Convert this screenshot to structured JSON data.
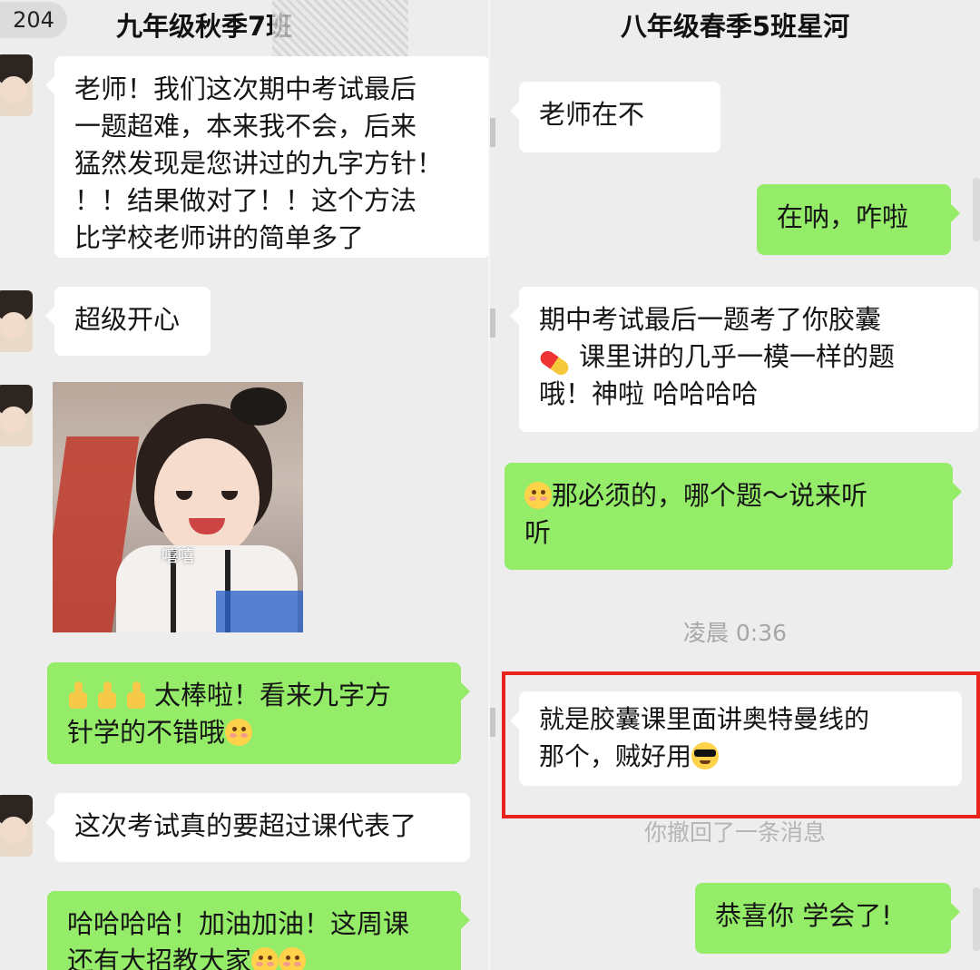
{
  "left_pane": {
    "badge": "204",
    "title": "九年级秋季7班",
    "messages": [
      "老师！我们这次期中考试最后\n一题超难，本来我不会，后来\n猛然发现是您讲过的九字方针！\n！！结果做对了！！这个方法\n比学校老师讲的简单多了",
      "超级开心",
      "太棒啦！看来九字方\n针学的不错哦",
      "这次考试真的要超过课代表了",
      "哈哈哈哈！加油加油！这周课\n还有大招教大家"
    ],
    "sticker_caption": "嘻嘻"
  },
  "right_pane": {
    "title": "八年级春季5班星河",
    "messages": [
      "老师在不",
      "在呐，咋啦",
      "期中考试最后一题考了你胶囊",
      "课里讲的几乎一模一样的题\n哦！神啦 哈哈哈哈",
      "那必须的，哪个题～说来听\n听",
      "就是胶囊课里面讲奥特曼线的\n那个，贼好用",
      "恭喜你 学会了!"
    ],
    "timestamp": "凌晨 0:36",
    "recall_notice": "你撤回了一条消息"
  },
  "colors": {
    "background": "#ededed",
    "bubble_incoming": "#ffffff",
    "bubble_outgoing": "#95ec69",
    "highlight_box": "#e8231b"
  },
  "icons": [
    "thumbs-up-icon",
    "blushing-face-icon",
    "pill-icon",
    "sunglasses-face-icon",
    "avatar-icon"
  ]
}
